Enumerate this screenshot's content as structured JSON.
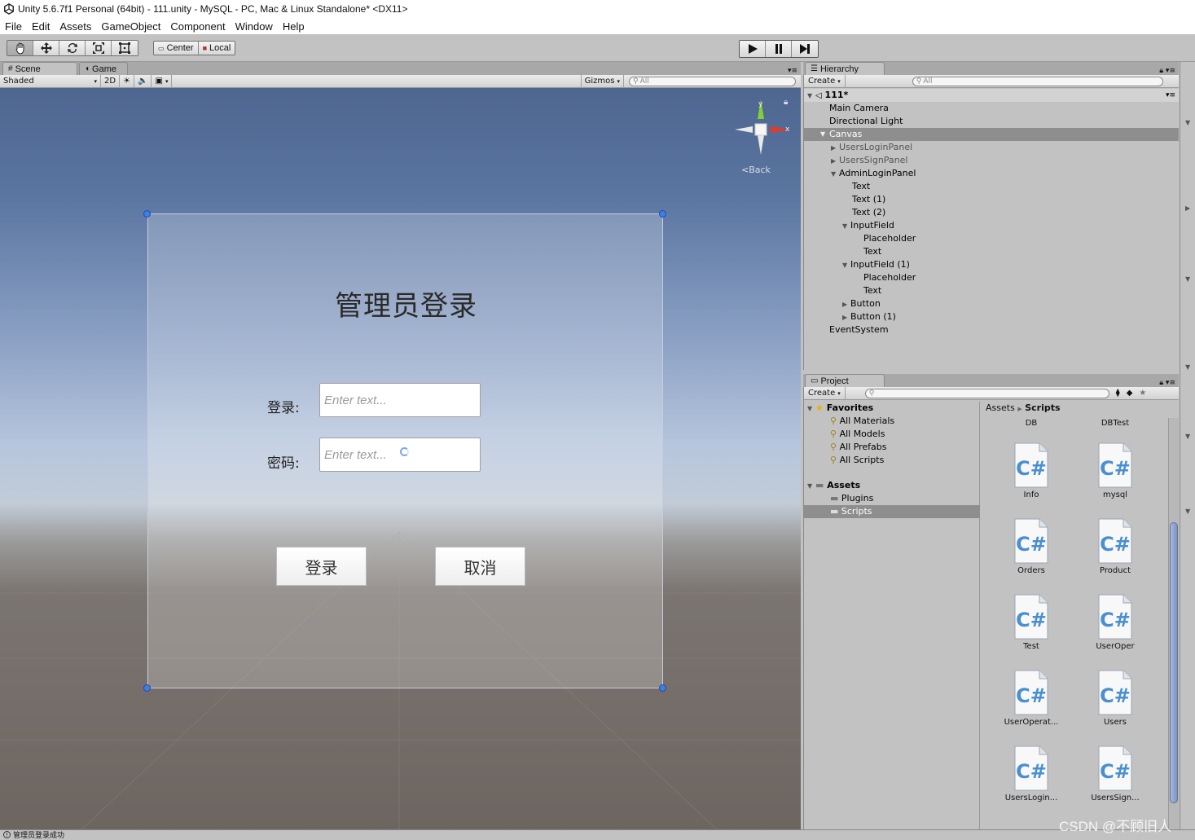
{
  "window": {
    "title": "Unity 5.6.7f1 Personal (64bit) - 111.unity - MySQL - PC, Mac & Linux Standalone* <DX11>"
  },
  "menu": [
    "File",
    "Edit",
    "Assets",
    "GameObject",
    "Component",
    "Window",
    "Help"
  ],
  "toolbar": {
    "center_label": "Center",
    "local_label": "Local"
  },
  "scene": {
    "tab_scene": "Scene",
    "tab_game": "Game",
    "shading": "Shaded",
    "mode_2d": "2D",
    "gizmos": "Gizmos",
    "search_placeholder": "All",
    "back_label": "Back",
    "axis_y": "y",
    "axis_x": "x"
  },
  "login_ui": {
    "title": "管理员登录",
    "login_label": "登录:",
    "password_label": "密码:",
    "input_placeholder": "Enter text...",
    "input2_placeholder": "Enter text...",
    "login_button": "登录",
    "cancel_button": "取消"
  },
  "hierarchy": {
    "tab": "Hierarchy",
    "create": "Create",
    "search_placeholder": "All",
    "scene_name": "111*",
    "items": [
      {
        "label": "Main Camera"
      },
      {
        "label": "Directional Light"
      },
      {
        "label": "Canvas"
      },
      {
        "label": "UsersLoginPanel"
      },
      {
        "label": "UsersSignPanel"
      },
      {
        "label": "AdminLoginPanel"
      },
      {
        "label": "Text"
      },
      {
        "label": "Text (1)"
      },
      {
        "label": "Text (2)"
      },
      {
        "label": "InputField"
      },
      {
        "label": "Placeholder"
      },
      {
        "label": "Text"
      },
      {
        "label": "InputField (1)"
      },
      {
        "label": "Placeholder"
      },
      {
        "label": "Text"
      },
      {
        "label": "Button"
      },
      {
        "label": "Button (1)"
      },
      {
        "label": "EventSystem"
      }
    ]
  },
  "project": {
    "tab": "Project",
    "create": "Create",
    "favorites_label": "Favorites",
    "favorites": [
      "All Materials",
      "All Models",
      "All Prefabs",
      "All Scripts"
    ],
    "assets_label": "Assets",
    "folders": [
      "Plugins",
      "Scripts"
    ],
    "breadcrumb_root": "Assets",
    "breadcrumb_current": "Scripts",
    "top_labels": [
      "DB",
      "DBTest"
    ],
    "files": [
      "Info",
      "mysql",
      "Orders",
      "Product",
      "Test",
      "UserOper",
      "UserOperat...",
      "Users",
      "UsersLogin...",
      "UsersSign..."
    ]
  },
  "status": {
    "message": "管理员登录成功"
  },
  "watermark": "CSDN @不顾旧人"
}
